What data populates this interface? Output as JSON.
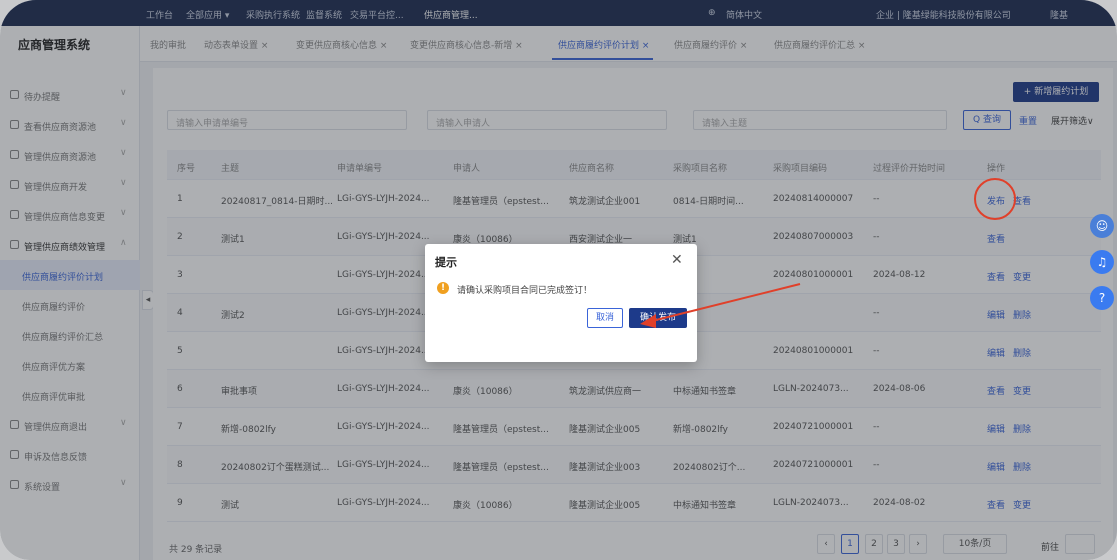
{
  "topbar": {
    "items": [
      "工作台",
      "全部应用 ▾",
      "采购执行系统",
      "监督系统",
      "交易平台控...",
      "供应商管理..."
    ],
    "lang": "简体中文",
    "company": "企业 | 隆基绿能科技股份有限公司",
    "user": "隆基"
  },
  "tabs": [
    "我的审批",
    "动态表单设置 ×",
    "变更供应商核心信息 ×",
    "变更供应商核心信息-新增 ×",
    "供应商履约评价计划 ×",
    "供应商履约评价 ×",
    "供应商履约评价汇总 ×"
  ],
  "sidebar": {
    "brand": "应商管理系统",
    "items": [
      {
        "label": "待办提醒",
        "chev": "∨"
      },
      {
        "label": "查看供应商资源池",
        "chev": "∨"
      },
      {
        "label": "管理供应商资源池",
        "chev": "∨"
      },
      {
        "label": "管理供应商开发",
        "chev": "∨"
      },
      {
        "label": "管理供应商信息变更",
        "chev": "∨"
      },
      {
        "label": "管理供应商绩效管理",
        "chev": "∧"
      },
      {
        "label": "供应商履约评价计划",
        "chev": ""
      },
      {
        "label": "供应商履约评价",
        "chev": ""
      },
      {
        "label": "供应商履约评价汇总",
        "chev": ""
      },
      {
        "label": "供应商评优方案",
        "chev": ""
      },
      {
        "label": "供应商评优审批",
        "chev": ""
      },
      {
        "label": "管理供应商退出",
        "chev": "∨"
      },
      {
        "label": "申诉及信息反馈",
        "chev": ""
      },
      {
        "label": "系统设置",
        "chev": "∨"
      }
    ]
  },
  "toolbar": {
    "new_label": "+ 新增履约计划",
    "filter_request_no": "请输入申请单编号",
    "filter_applicant": "请输入申请人",
    "filter_subject": "请输入主题",
    "query_label": "Q 查询",
    "reset_label": "重置",
    "expand_label": "展开筛选∨"
  },
  "table": {
    "headers": [
      "序号",
      "主题",
      "申请单编号",
      "申请人",
      "供应商名称",
      "采购项目名称",
      "采购项目编码",
      "过程评价开始时间",
      "操作"
    ],
    "rows": [
      [
        "1",
        "20240817_0814-日期时...",
        "LGi-GYS-LYJH-2024...",
        "隆基管理员（epstest...",
        "筑龙测试企业001",
        "0814-日期时间...",
        "20240814000007",
        "--",
        "发布",
        "查看"
      ],
      [
        "2",
        "测试1",
        "LGi-GYS-LYJH-2024...",
        "康炎（10086）",
        "西安测试企业一",
        "测试1",
        "20240807000003",
        "--",
        "查看",
        ""
      ],
      [
        "3",
        "",
        "LGi-GYS-LYJH-2024...",
        "",
        "",
        "",
        "20240801000001",
        "2024-08-12",
        "查看",
        "变更"
      ],
      [
        "4",
        "测试2",
        "LGi-GYS-LYJH-2024...",
        "",
        "",
        "",
        "",
        "--",
        "编辑",
        "删除"
      ],
      [
        "5",
        "",
        "LGi-GYS-LYJH-2024...",
        "隆基管理员（epstest...",
        "筑龙测试企业001",
        "",
        "20240801000001",
        "--",
        "编辑",
        "删除"
      ],
      [
        "6",
        "审批事项",
        "LGi-GYS-LYJH-2024...",
        "康炎（10086）",
        "筑龙测试供应商一",
        "中标通知书签章",
        "LGLN-2024073...",
        "2024-08-06",
        "查看",
        "变更"
      ],
      [
        "7",
        "新增-0802lfy",
        "LGi-GYS-LYJH-2024...",
        "隆基管理员（epstest...",
        "隆基测试企业005",
        "新增-0802lfy",
        "20240721000001",
        "--",
        "编辑",
        "删除"
      ],
      [
        "8",
        "20240802订个蛋糕测试...",
        "LGi-GYS-LYJH-2024...",
        "隆基管理员（epstest...",
        "隆基测试企业003",
        "20240802订个...",
        "20240721000001",
        "--",
        "编辑",
        "删除"
      ],
      [
        "9",
        "测试",
        "LGi-GYS-LYJH-2024...",
        "康炎（10086）",
        "隆基测试企业005",
        "中标通知书签章",
        "LGLN-2024073...",
        "2024-08-02",
        "查看",
        "变更"
      ]
    ]
  },
  "footer": {
    "total": "共 29 条记录",
    "pages": [
      "1",
      "2",
      "3"
    ],
    "page_size": "10条/页",
    "goto": "前往"
  },
  "dialog": {
    "title": "提示",
    "message": "请确认采购项目合同已完成签订！",
    "cancel": "取消",
    "confirm": "确认发布"
  }
}
